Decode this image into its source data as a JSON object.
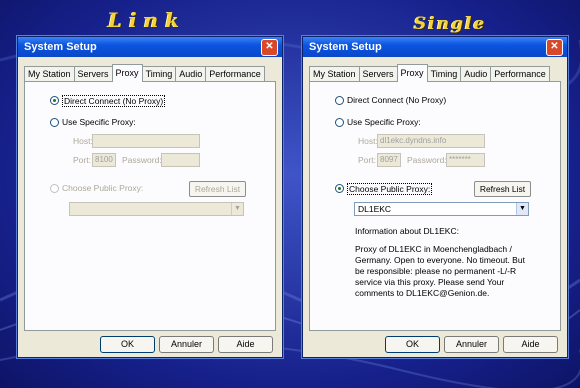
{
  "captions": {
    "left": "Link",
    "right": "Single"
  },
  "colors": {
    "titlebar": "#0b55e0",
    "caption": "#f4d23a",
    "close": "#d8482a"
  },
  "left_dialog": {
    "title": "System Setup",
    "close_label": "✕",
    "tabs": [
      "My Station",
      "Servers",
      "Proxy",
      "Timing",
      "Audio",
      "Performance"
    ],
    "active_tab": "Proxy",
    "direct_connect": "Direct Connect (No Proxy)",
    "use_specific": "Use Specific Proxy:",
    "host_label": "Host:",
    "host_value": "",
    "port_label": "Port:",
    "port_value": "8100",
    "password_label": "Password:",
    "password_value": "",
    "public_proxy": "Choose Public Proxy:",
    "refresh": "Refresh List",
    "select_value": "",
    "ok": "OK",
    "cancel": "Annuler",
    "help": "Aide"
  },
  "right_dialog": {
    "title": "System Setup",
    "close_label": "✕",
    "tabs": [
      "My Station",
      "Servers",
      "Proxy",
      "Timing",
      "Audio",
      "Performance"
    ],
    "active_tab": "Proxy",
    "direct_connect": "Direct Connect (No Proxy)",
    "use_specific": "Use Specific Proxy:",
    "host_label": "Host:",
    "host_value": "dl1ekc.dyndns.info",
    "port_label": "Port:",
    "port_value": "8097",
    "password_label": "Password:",
    "password_value": "*******",
    "public_proxy": "Choose Public Proxy:",
    "refresh": "Refresh List",
    "select_value": "DL1EKC",
    "info_title": "Information about DL1EKC:",
    "info_text": "Proxy of DL1EKC in Moenchengladbach / Germany. Open to everyone. No timeout. But be responsible: please no permanent -L/-R service via this proxy. Please send Your comments to DL1EKC@Genion.de.",
    "ok": "OK",
    "cancel": "Annuler",
    "help": "Aide"
  }
}
